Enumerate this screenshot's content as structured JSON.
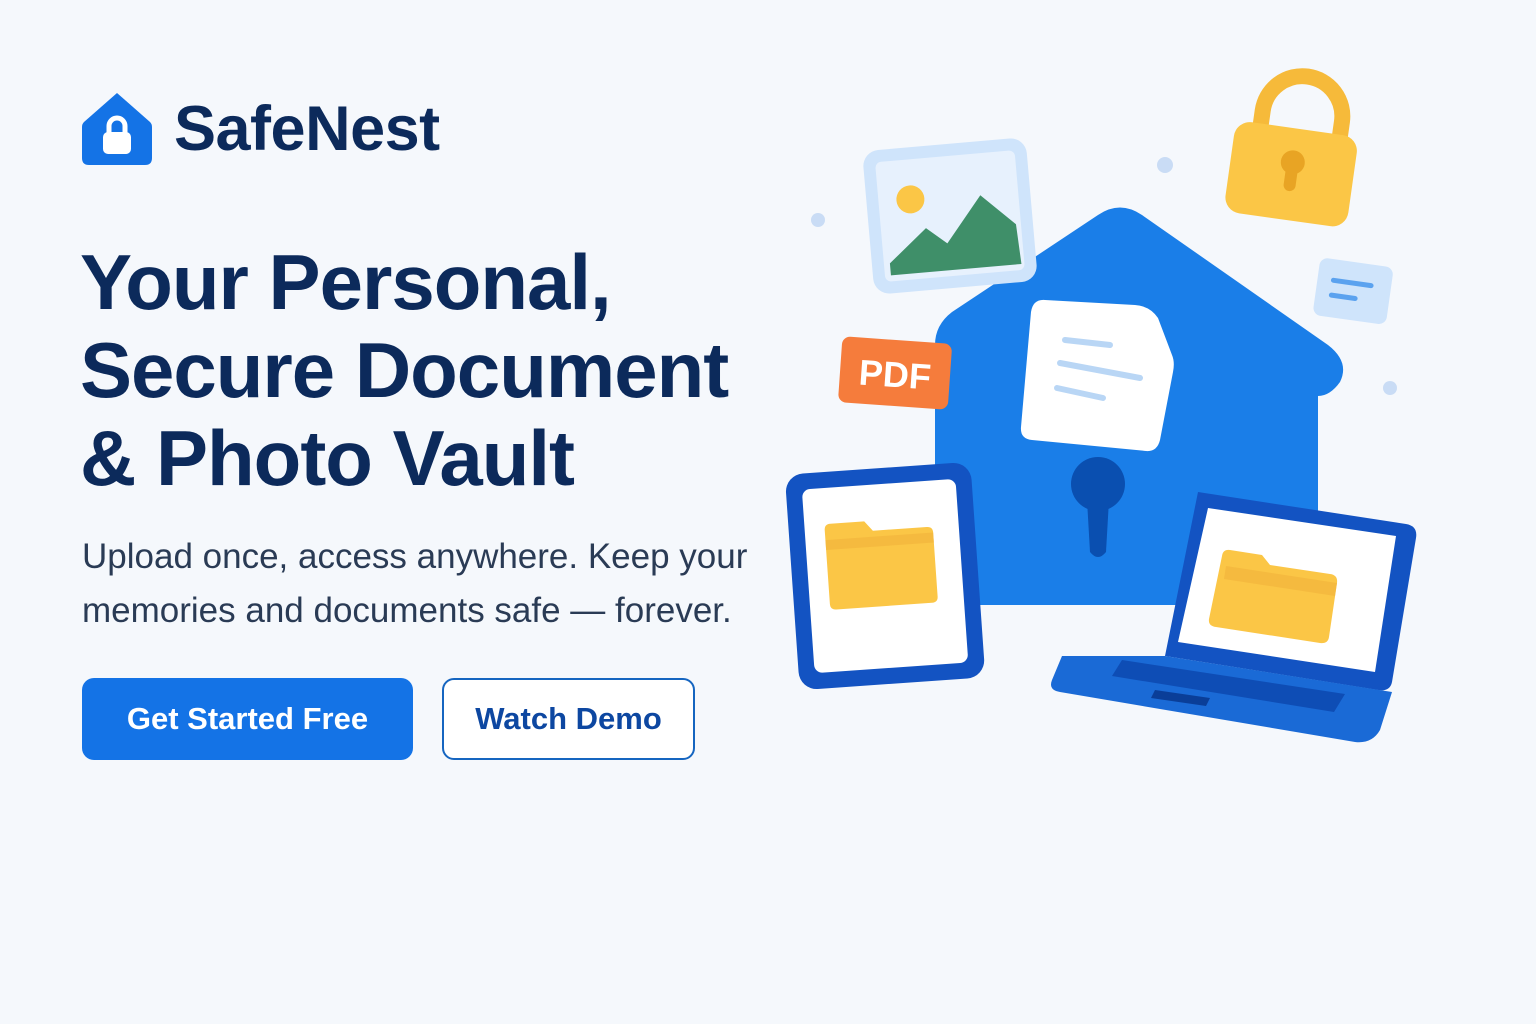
{
  "brand": {
    "name": "SafeNest",
    "logo_icon": "house-lock-icon"
  },
  "hero": {
    "headline_lines": [
      "Your Personal,",
      "Secure Document",
      "& Photo Vault"
    ],
    "subtitle_lines": [
      "Upload once, access anywhere. Keep your",
      "memories and documents safe — forever."
    ],
    "primary_button_label": "Get Started Free",
    "secondary_button_label": "Watch Demo"
  },
  "illustration": {
    "pdf_badge_label": "PDF",
    "icons": [
      "house-keyhole-icon",
      "image-icon",
      "padlock-icon",
      "pdf-icon",
      "document-icon",
      "tablet-folder-icon",
      "laptop-folder-icon",
      "message-icon"
    ]
  },
  "colors": {
    "background": "#f5f8fc",
    "primary_blue": "#1473e6",
    "navy_text": "#0c2a5b",
    "folder_yellow": "#fbc646",
    "lock_yellow": "#f8bf3f",
    "pdf_orange": "#f57c3c",
    "image_green": "#3f8f69"
  }
}
